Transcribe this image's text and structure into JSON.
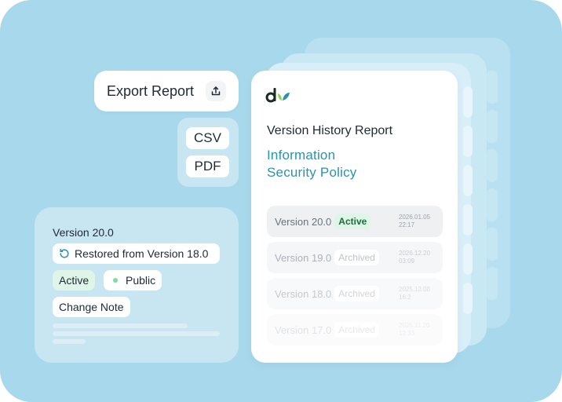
{
  "export": {
    "label": "Export Report",
    "icon": "upload-icon"
  },
  "formats": [
    "CSV",
    "PDF"
  ],
  "version_card": {
    "title": "Version 20.0",
    "restored_label": "Restored from Version 18.0",
    "status_label": "Active",
    "visibility_label": "Public",
    "note_label": "Change Note"
  },
  "report": {
    "heading": "Version History Report",
    "policy_line1": "Information",
    "policy_line2": "Security Policy",
    "rows": [
      {
        "version": "Version 20.0",
        "status": "Active",
        "ts_date": "2026.01.05",
        "ts_time": "22:17"
      },
      {
        "version": "Version 19.0",
        "status": "Archived",
        "ts_date": "2026.12.20",
        "ts_time": "03:09"
      },
      {
        "version": "Version 18.0",
        "status": "Archived",
        "ts_date": "2025.12.08",
        "ts_time": "16:2"
      },
      {
        "version": "Version 17.0",
        "status": "Archived",
        "ts_date": "2025.11.20",
        "ts_time": "12:33"
      }
    ]
  },
  "colors": {
    "background": "#a8d8ec",
    "accent": "#2a93ad",
    "active_badge": "#dff5e7",
    "logo_dark": "#1a2b24",
    "logo_green": "#8fd14f",
    "logo_blue": "#2a93ad"
  }
}
